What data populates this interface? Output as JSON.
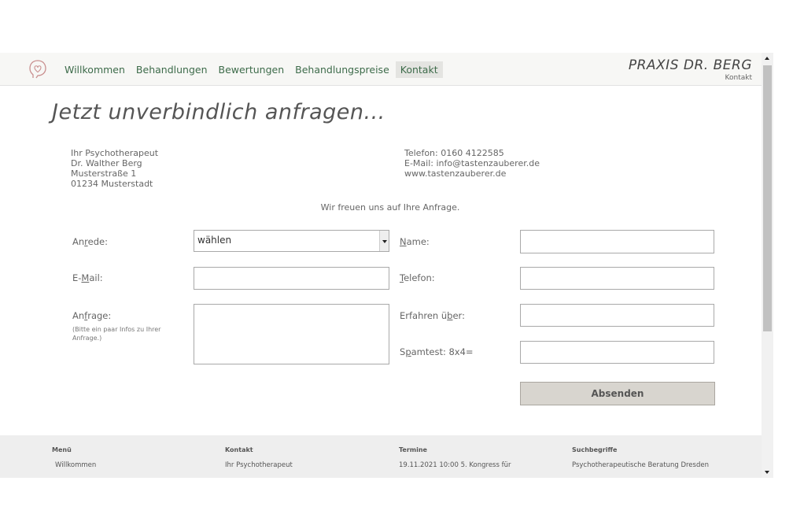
{
  "nav": {
    "items": [
      "Willkommen",
      "Behandlungen",
      "Bewertungen",
      "Behandlungspreise",
      "Kontakt"
    ],
    "active": "Kontakt"
  },
  "brand": {
    "title": "PRAXIS DR. BERG",
    "subtitle": "Kontakt"
  },
  "page_title": "Jetzt unverbindlich anfragen...",
  "address": {
    "line1": "Ihr Psychotherapeut",
    "line2": "Dr. Walther Berg",
    "line3": "Musterstraße 1",
    "line4": "01234 Musterstadt"
  },
  "contact": {
    "phone": "Telefon: 0160 4122585",
    "email": "E-Mail: info@tastenzauberer.de",
    "web": "www.tastenzauberer.de"
  },
  "intro": "Wir freuen uns auf Ihre Anfrage.",
  "form": {
    "anrede_pre": "An",
    "anrede_u": "r",
    "anrede_post": "ede:",
    "anrede_value": "wählen",
    "name_u": "N",
    "name_post": "ame:",
    "email_pre": "E-",
    "email_u": "M",
    "email_post": "ail:",
    "telefon_u": "T",
    "telefon_post": "elefon:",
    "anfrage_pre": "An",
    "anfrage_u": "f",
    "anfrage_post": "rage:",
    "anfrage_hint_1": "(Bitte ein paar Infos zu Ihrer",
    "anfrage_hint_2": "Anfrage.)",
    "erfahren_pre": "Erfahren ü",
    "erfahren_u": "b",
    "erfahren_post": "er:",
    "spam_pre": "S",
    "spam_u": "p",
    "spam_post": "amtest: 8x4=",
    "submit": "Absenden"
  },
  "footer": {
    "menu": {
      "heading": "Menü",
      "item": "Willkommen"
    },
    "kontakt": {
      "heading": "Kontakt",
      "item": "Ihr Psychotherapeut"
    },
    "termine": {
      "heading": "Termine",
      "item": "19.11.2021 10:00 5. Kongress für"
    },
    "suchbegriffe": {
      "heading": "Suchbegriffe",
      "item": "Psychotherapeutische Beratung Dresden"
    }
  },
  "colors": {
    "nav_link": "#3d6b4a",
    "footer_bg": "#eeeeee",
    "button_bg": "#d8d5cf"
  },
  "icons": {
    "logo": "head-outline-icon"
  }
}
